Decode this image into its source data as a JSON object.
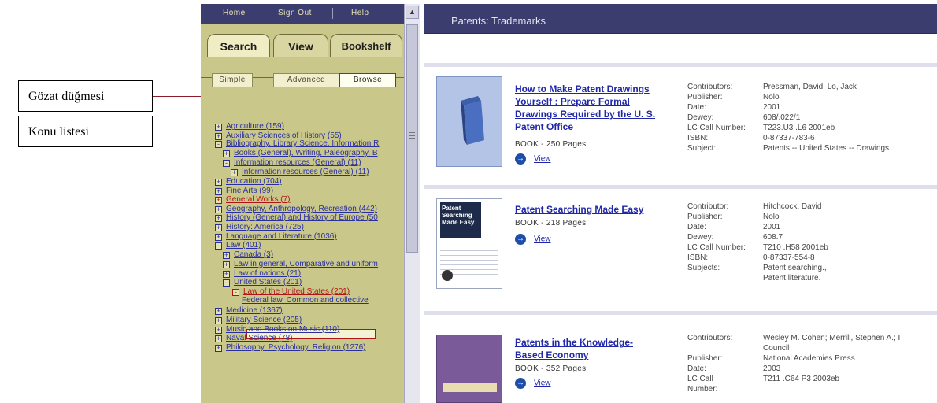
{
  "callouts": {
    "browse_button": "Gözat düğmesi",
    "subject_list": "Konu listesi"
  },
  "left": {
    "nav": [
      "Home",
      "Sign Out",
      "Help"
    ],
    "tabs": [
      "Search",
      "View",
      "Bookshelf"
    ],
    "modes": [
      "Simple",
      "Advanced",
      "Browse"
    ],
    "tree": [
      {
        "label": "Agriculture (159)",
        "box": "+"
      },
      {
        "label": "Auxiliary Sciences of History (55)",
        "box": "+"
      },
      {
        "label": "Bibliography, Library Science, Information R",
        "box": "-"
      },
      {
        "label": "Books (General), Writing, Paleography, B",
        "box": "+"
      },
      {
        "label": "Information resources (General) (11)",
        "box": "-"
      },
      {
        "label": "Information resources (General) (11)",
        "box": "+"
      },
      {
        "label": "Education (704)",
        "box": "+"
      },
      {
        "label": "Fine Arts (99)",
        "box": "+"
      },
      {
        "label": "General Works (7)",
        "box": "+"
      },
      {
        "label": "Geography, Anthropology, Recreation (442)",
        "box": "+"
      },
      {
        "label": "History (General) and History of Europe (50",
        "box": "+"
      },
      {
        "label": "History: America (725)",
        "box": "+"
      },
      {
        "label": "Language and Literature (1036)",
        "box": "+"
      },
      {
        "label": "Law (401)",
        "box": "-"
      },
      {
        "label": "Canada (3)",
        "box": "+"
      },
      {
        "label": "Law in general, Comparative and uniform",
        "box": "+"
      },
      {
        "label": "Law of nations (21)",
        "box": "+"
      },
      {
        "label": "United States (201)",
        "box": "-"
      },
      {
        "label": "Law of the United States (201)",
        "box": "-"
      },
      {
        "label": "Federal law. Common and collective",
        "box": ""
      },
      {
        "label": "Medicine (1367)",
        "box": "+"
      },
      {
        "label": "Military Science (205)",
        "box": "+"
      },
      {
        "label": "Music and Books on Music (110)",
        "box": "+"
      },
      {
        "label": "Naval Science (78)",
        "box": "+"
      },
      {
        "label": "Philosophy, Psychology, Religion (1276)",
        "box": "+"
      }
    ]
  },
  "right": {
    "header_title": "Patents: Trademarks",
    "records": [
      {
        "title": "How to Make Patent Drawings Yourself : Prepare Formal Drawings Required by the U. S. Patent Office",
        "title_lines": [
          "How to Make Patent Drawings",
          "Yourself : Prepare Formal",
          "Drawings Required by the U. S.",
          "Patent Office"
        ],
        "meta": "BOOK - 250 Pages",
        "view": "View",
        "fields": [
          [
            "Contributors:",
            "Pressman, David; Lo, Jack"
          ],
          [
            "Publisher:",
            "Nolo"
          ],
          [
            "Date:",
            "2001"
          ],
          [
            "Dewey:",
            "608/.022/1"
          ],
          [
            "LC Call Number:",
            "T223.U3 .L6 2001eb"
          ],
          [
            "ISBN:",
            "0-87337-783-6"
          ],
          [
            "Subject:",
            "Patents -- United States -- Drawings."
          ]
        ]
      },
      {
        "title": "Patent Searching Made Easy",
        "title_lines": [
          "Patent Searching Made Easy"
        ],
        "meta": "BOOK - 218 Pages",
        "view": "View",
        "cover_text": [
          "Patent",
          "Searching",
          "Made Easy"
        ],
        "fields": [
          [
            "Contributor:",
            "Hitchcock, David"
          ],
          [
            "Publisher:",
            "Nolo"
          ],
          [
            "Date:",
            "2001"
          ],
          [
            "Dewey:",
            "608.7"
          ],
          [
            "LC Call Number:",
            "T210 .H58 2001eb"
          ],
          [
            "ISBN:",
            "0-87337-554-8"
          ],
          [
            "Subjects:",
            "Patent searching.,"
          ],
          [
            "",
            "Patent literature."
          ]
        ]
      },
      {
        "title": "Patents in the Knowledge-Based Economy",
        "title_lines": [
          "Patents in the Knowledge-",
          "Based Economy"
        ],
        "meta": "BOOK - 352 Pages",
        "view": "View",
        "fields": [
          [
            "Contributors:",
            "Wesley M. Cohen; Merrill, Stephen A.; I"
          ],
          [
            "",
            "Council"
          ],
          [
            "Publisher:",
            "National Academies Press"
          ],
          [
            "Date:",
            "2003"
          ],
          [
            "LC Call",
            "T211 .C64 P3 2003eb"
          ],
          [
            "Number:",
            ""
          ]
        ]
      }
    ]
  },
  "colors": {
    "nav_bg": "#3b3d6e",
    "panel_bg": "#c9c78a",
    "link_blue": "#2a2fa0",
    "selected_red": "#b01515",
    "leader_line": "#8b1a2a"
  }
}
